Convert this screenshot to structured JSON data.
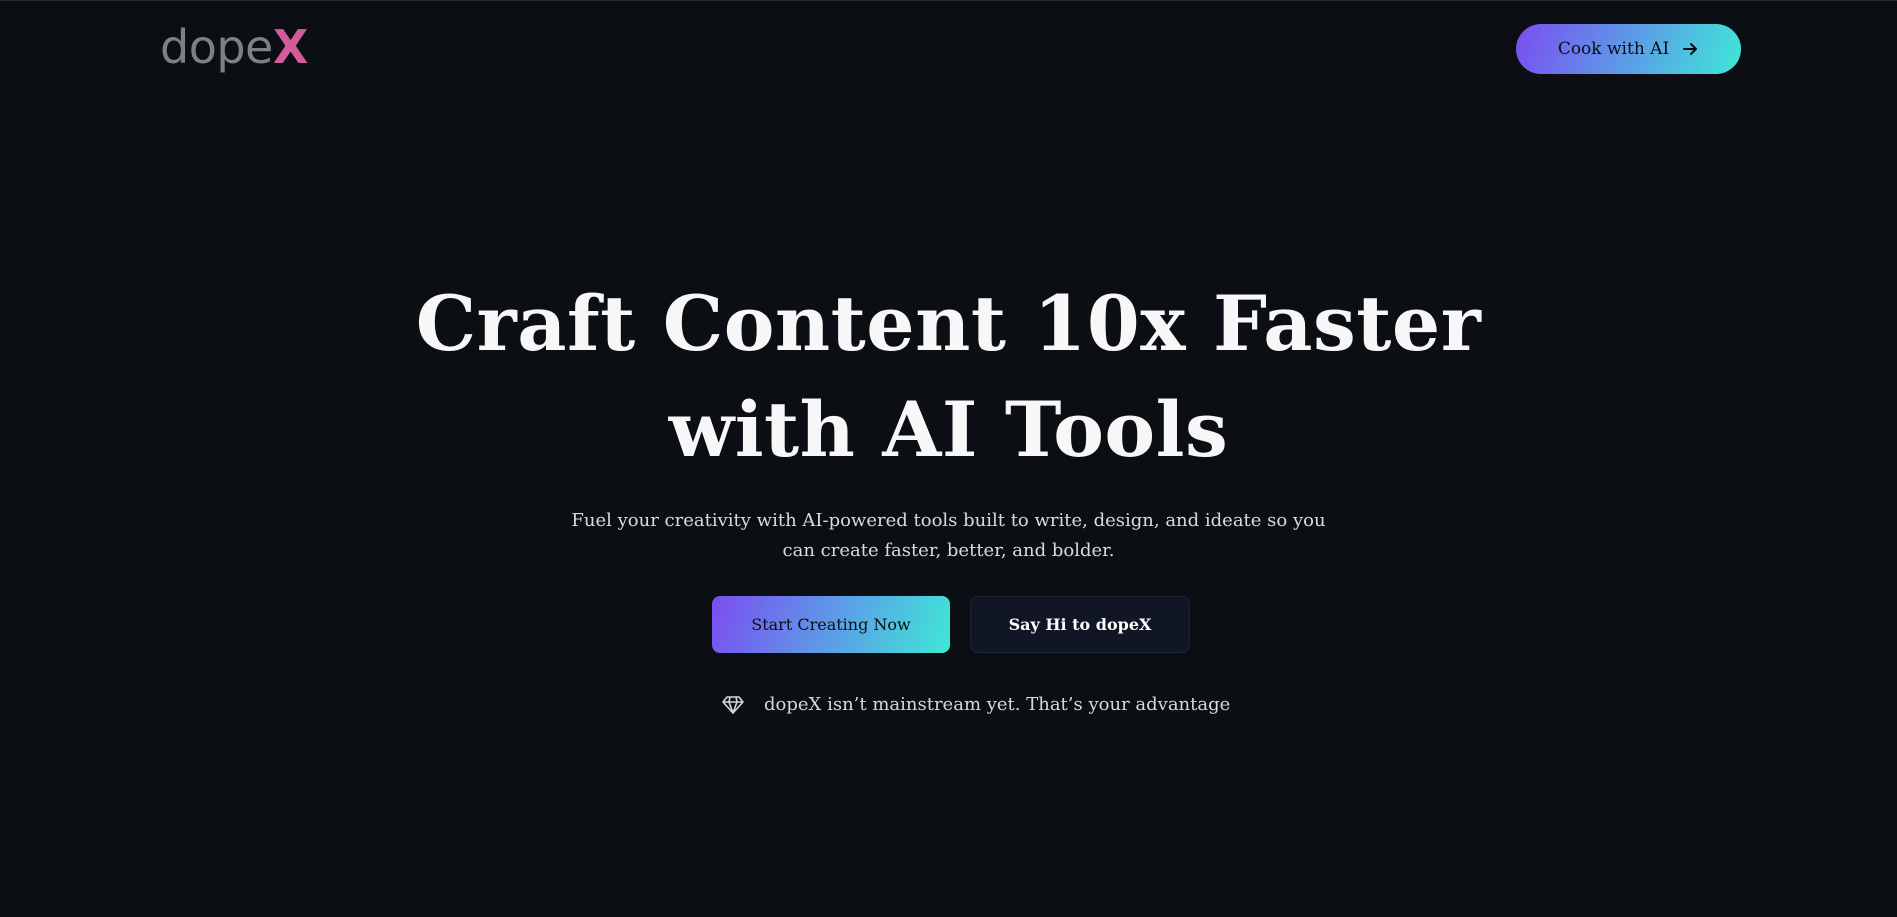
{
  "header": {
    "logo_main": "dope",
    "logo_accent": "X",
    "cta_label": "Cook with AI",
    "cta_icon": "arrow-right-icon"
  },
  "hero": {
    "title_line1": "Craft Content 10x Faster",
    "title_line2": "with AI Tools",
    "subtitle": "Fuel your creativity with AI-powered tools built to write, design, and ideate so you can create faster, better, and bolder.",
    "primary_button": "Start Creating Now",
    "secondary_button": "Say Hi to dopeX",
    "note_icon": "diamond-icon",
    "note_text": "dopeX isn’t mainstream yet. That’s your advantage"
  },
  "colors": {
    "background": "#0b0e13",
    "gradient_start": "#7b4df0",
    "gradient_end": "#3ee8d6",
    "logo_accent": "#d05c9b",
    "logo_main": "#7c8087"
  }
}
